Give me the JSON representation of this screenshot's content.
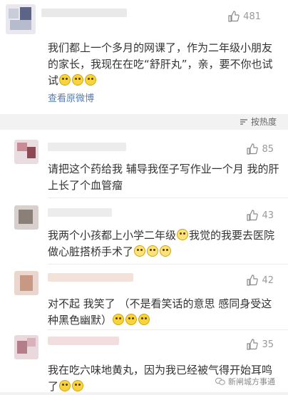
{
  "top_comment": {
    "likes": "481",
    "text": "我们都上一个多月的网课了，作为二年级小朋友的家长，我现在在吃“舒肝丸”，亲，要不你也试试",
    "link": "查看原微博"
  },
  "sort_label": "按热度",
  "comments": [
    {
      "likes": "85",
      "text": "请把这个药给我  辅导我侄子写作业一个月  我的肝上长了个血管瘤"
    },
    {
      "likes": "43",
      "text": "我两个小孩都上小学二年级",
      "text2": "我觉的我要去医院做心脏搭桥手术了"
    },
    {
      "likes": "42",
      "text": "对不起 我笑了 （不是看笑话的意思 感同身受这种黑色幽默）"
    },
    {
      "likes": "35",
      "text": "我在吃六味地黄丸，因为我已经被气得开始耳鸣了"
    }
  ],
  "watermark": "新闸城方事通"
}
